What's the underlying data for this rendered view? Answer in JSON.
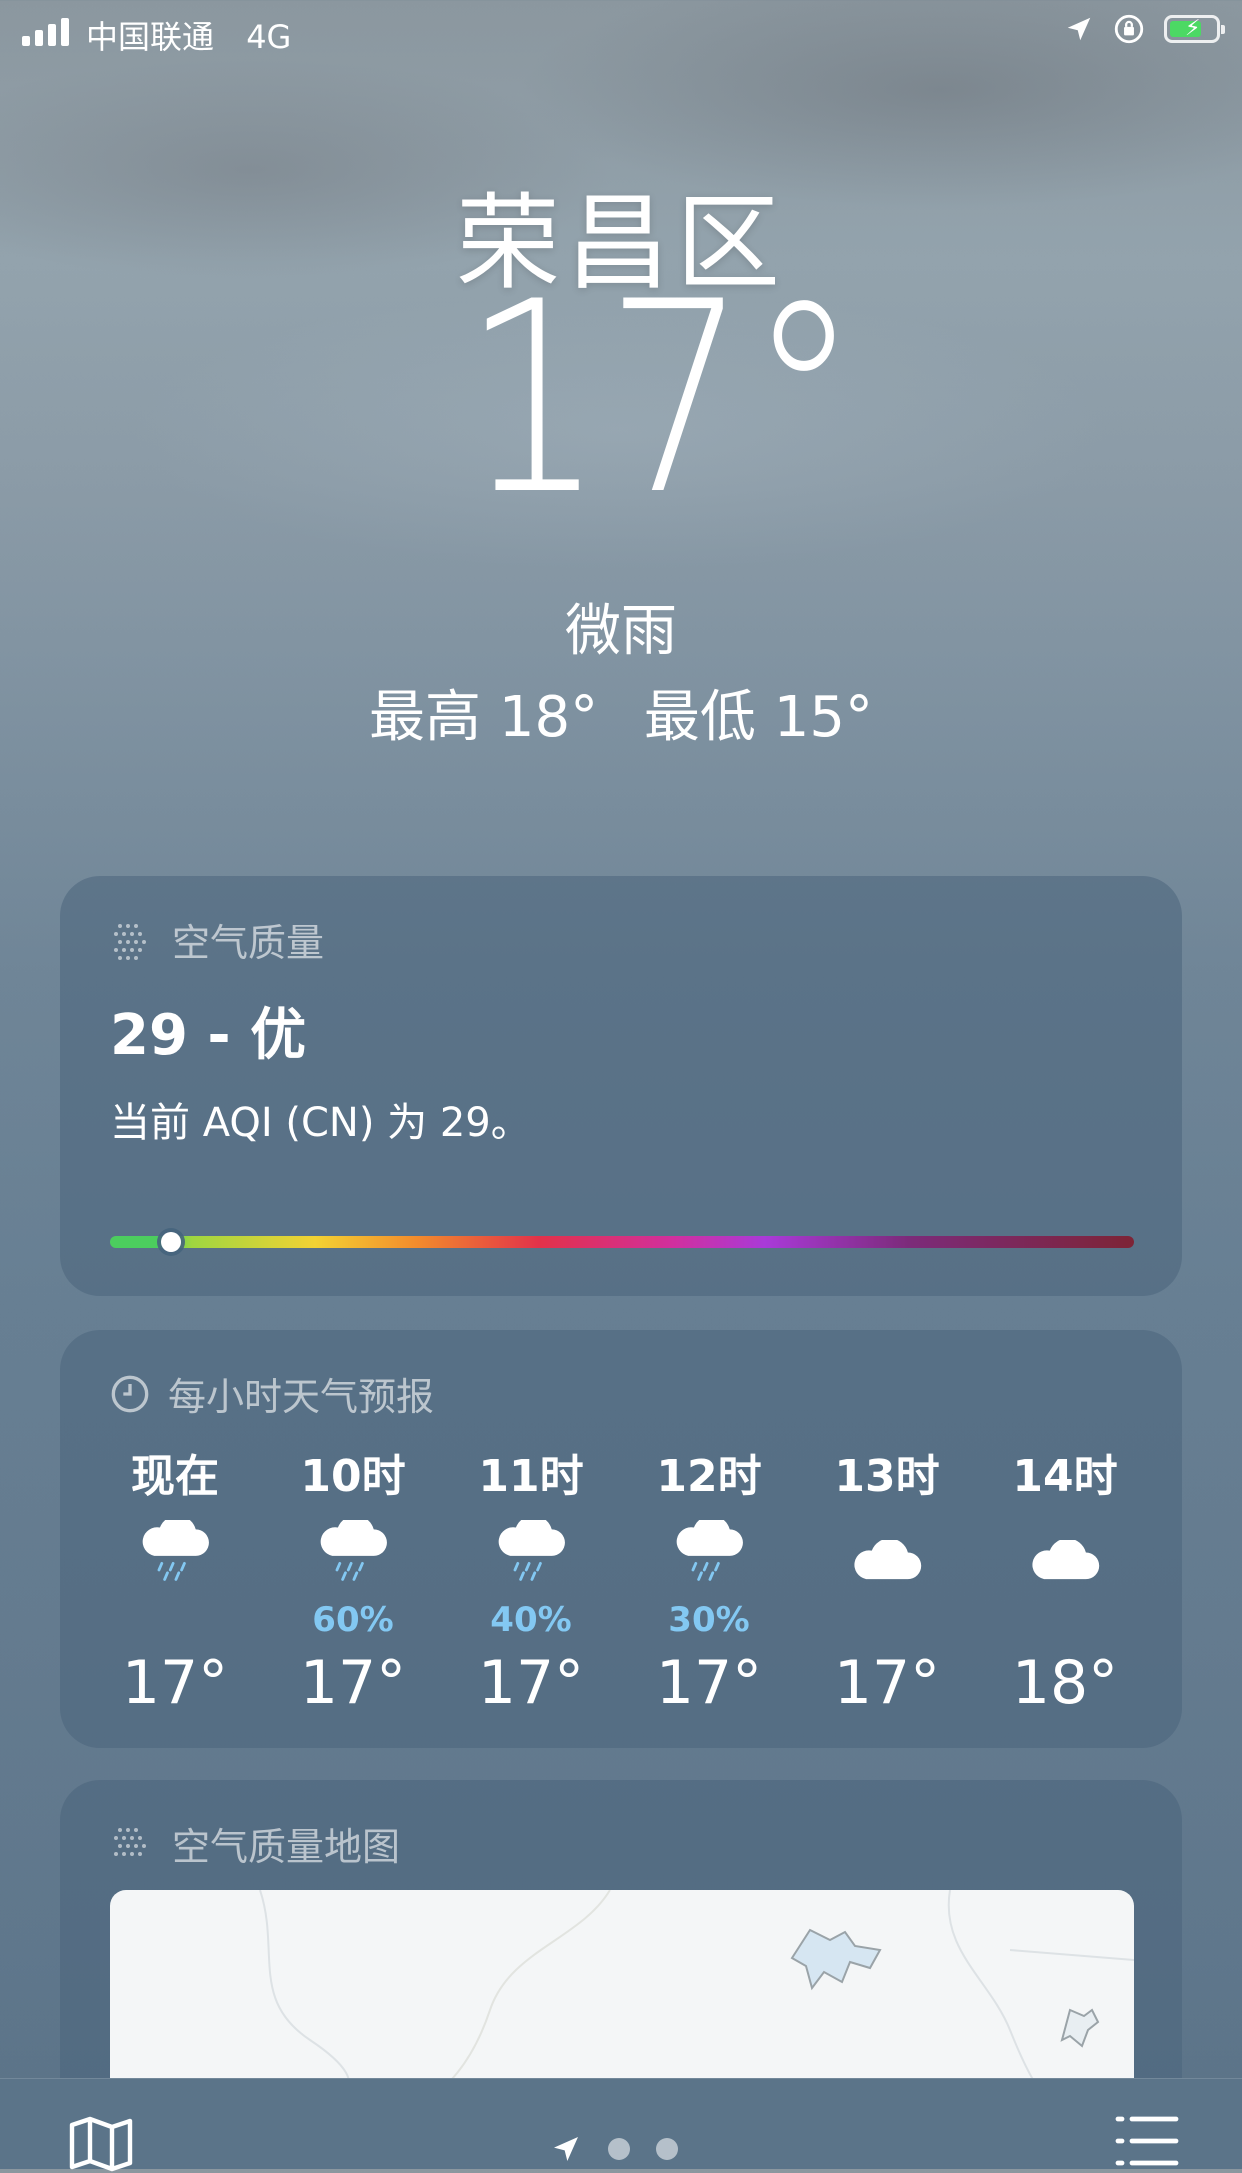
{
  "status_bar": {
    "carrier": "中国联通",
    "network": "4G"
  },
  "header": {
    "city": "荣昌区",
    "temperature": "17°",
    "condition": "微雨",
    "high": "最高 18°",
    "low": "最低 15°"
  },
  "air_quality": {
    "title": "空气质量",
    "value": "29 - 优",
    "description": "当前 AQI (CN) 为 29。",
    "level_fraction": 0.06
  },
  "hourly": {
    "title": "每小时天气预报",
    "items": [
      {
        "time": "现在",
        "icon": "cloud-rain-icon",
        "precip": "",
        "temp": "17°"
      },
      {
        "time": "10时",
        "icon": "cloud-rain-icon",
        "precip": "60%",
        "temp": "17°"
      },
      {
        "time": "11时",
        "icon": "cloud-rain-icon",
        "precip": "40%",
        "temp": "17°"
      },
      {
        "time": "12时",
        "icon": "cloud-rain-icon",
        "precip": "30%",
        "temp": "17°"
      },
      {
        "time": "13时",
        "icon": "cloud-icon",
        "precip": "",
        "temp": "17°"
      },
      {
        "time": "14时",
        "icon": "cloud-icon",
        "precip": "",
        "temp": "18°"
      }
    ]
  },
  "aq_map": {
    "title": "空气质量地图"
  },
  "colors": {
    "precip": "#83c8f2",
    "battery": "#4cd964",
    "card": "#4a647c"
  }
}
